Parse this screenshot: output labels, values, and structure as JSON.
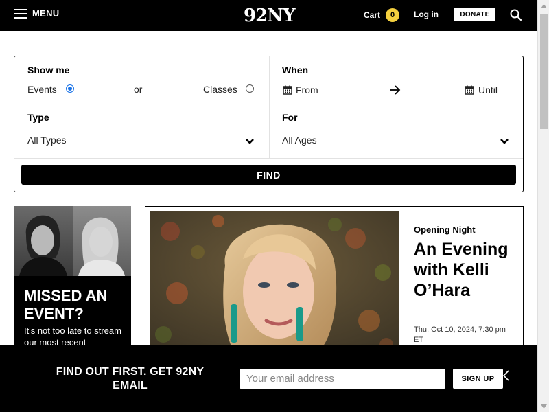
{
  "header": {
    "menu_label": "MENU",
    "logo": "92NY",
    "cart_label": "Cart",
    "cart_count": "0",
    "login_label": "Log in",
    "donate_label": "DONATE"
  },
  "filter": {
    "show_me_label": "Show me",
    "events_label": "Events",
    "or_label": "or",
    "classes_label": "Classes",
    "events_selected": true,
    "when_label": "When",
    "from_label": "From",
    "until_label": "Until",
    "type_label": "Type",
    "type_value": "All Types",
    "for_label": "For",
    "for_value": "All Ages",
    "find_label": "FIND"
  },
  "missed": {
    "title": "MISSED AN EVENT?",
    "subtitle": "It's not too late to stream our most recent"
  },
  "feature": {
    "tag": "Opening Night",
    "title": "An Evening with Kelli O’Hara",
    "date": "Thu, Oct 10, 2024, 7:30 pm ET"
  },
  "email_bar": {
    "heading": "FIND OUT FIRST. GET 92NY EMAIL",
    "placeholder": "Your email address",
    "signup_label": "SIGN UP"
  },
  "colors": {
    "header_bg": "#000000",
    "cart_badge": "#f4d03f",
    "radio_accent": "#1a73e8"
  }
}
